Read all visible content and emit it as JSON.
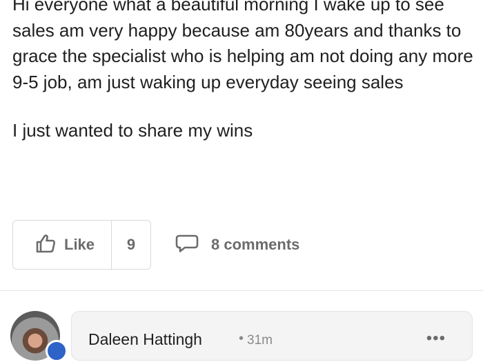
{
  "post": {
    "paragraphs": [
      "Hi everyone what a beautiful morning I wake up to see sales am very happy because am 80years and thanks to grace the specialist who is helping am not doing any more 9-5 job, am just waking up everyday seeing sales",
      "I just wanted to share my wins"
    ]
  },
  "actions": {
    "like_label": "Like",
    "like_count": "9",
    "comments_label": "8 comments"
  },
  "comment": {
    "author": "Daleen Hattingh",
    "separator": "•",
    "time": "31m",
    "more_icon": "more-dots-icon"
  },
  "icons": {
    "like": "thumbs-up-icon",
    "comments": "comment-bubble-icon"
  }
}
